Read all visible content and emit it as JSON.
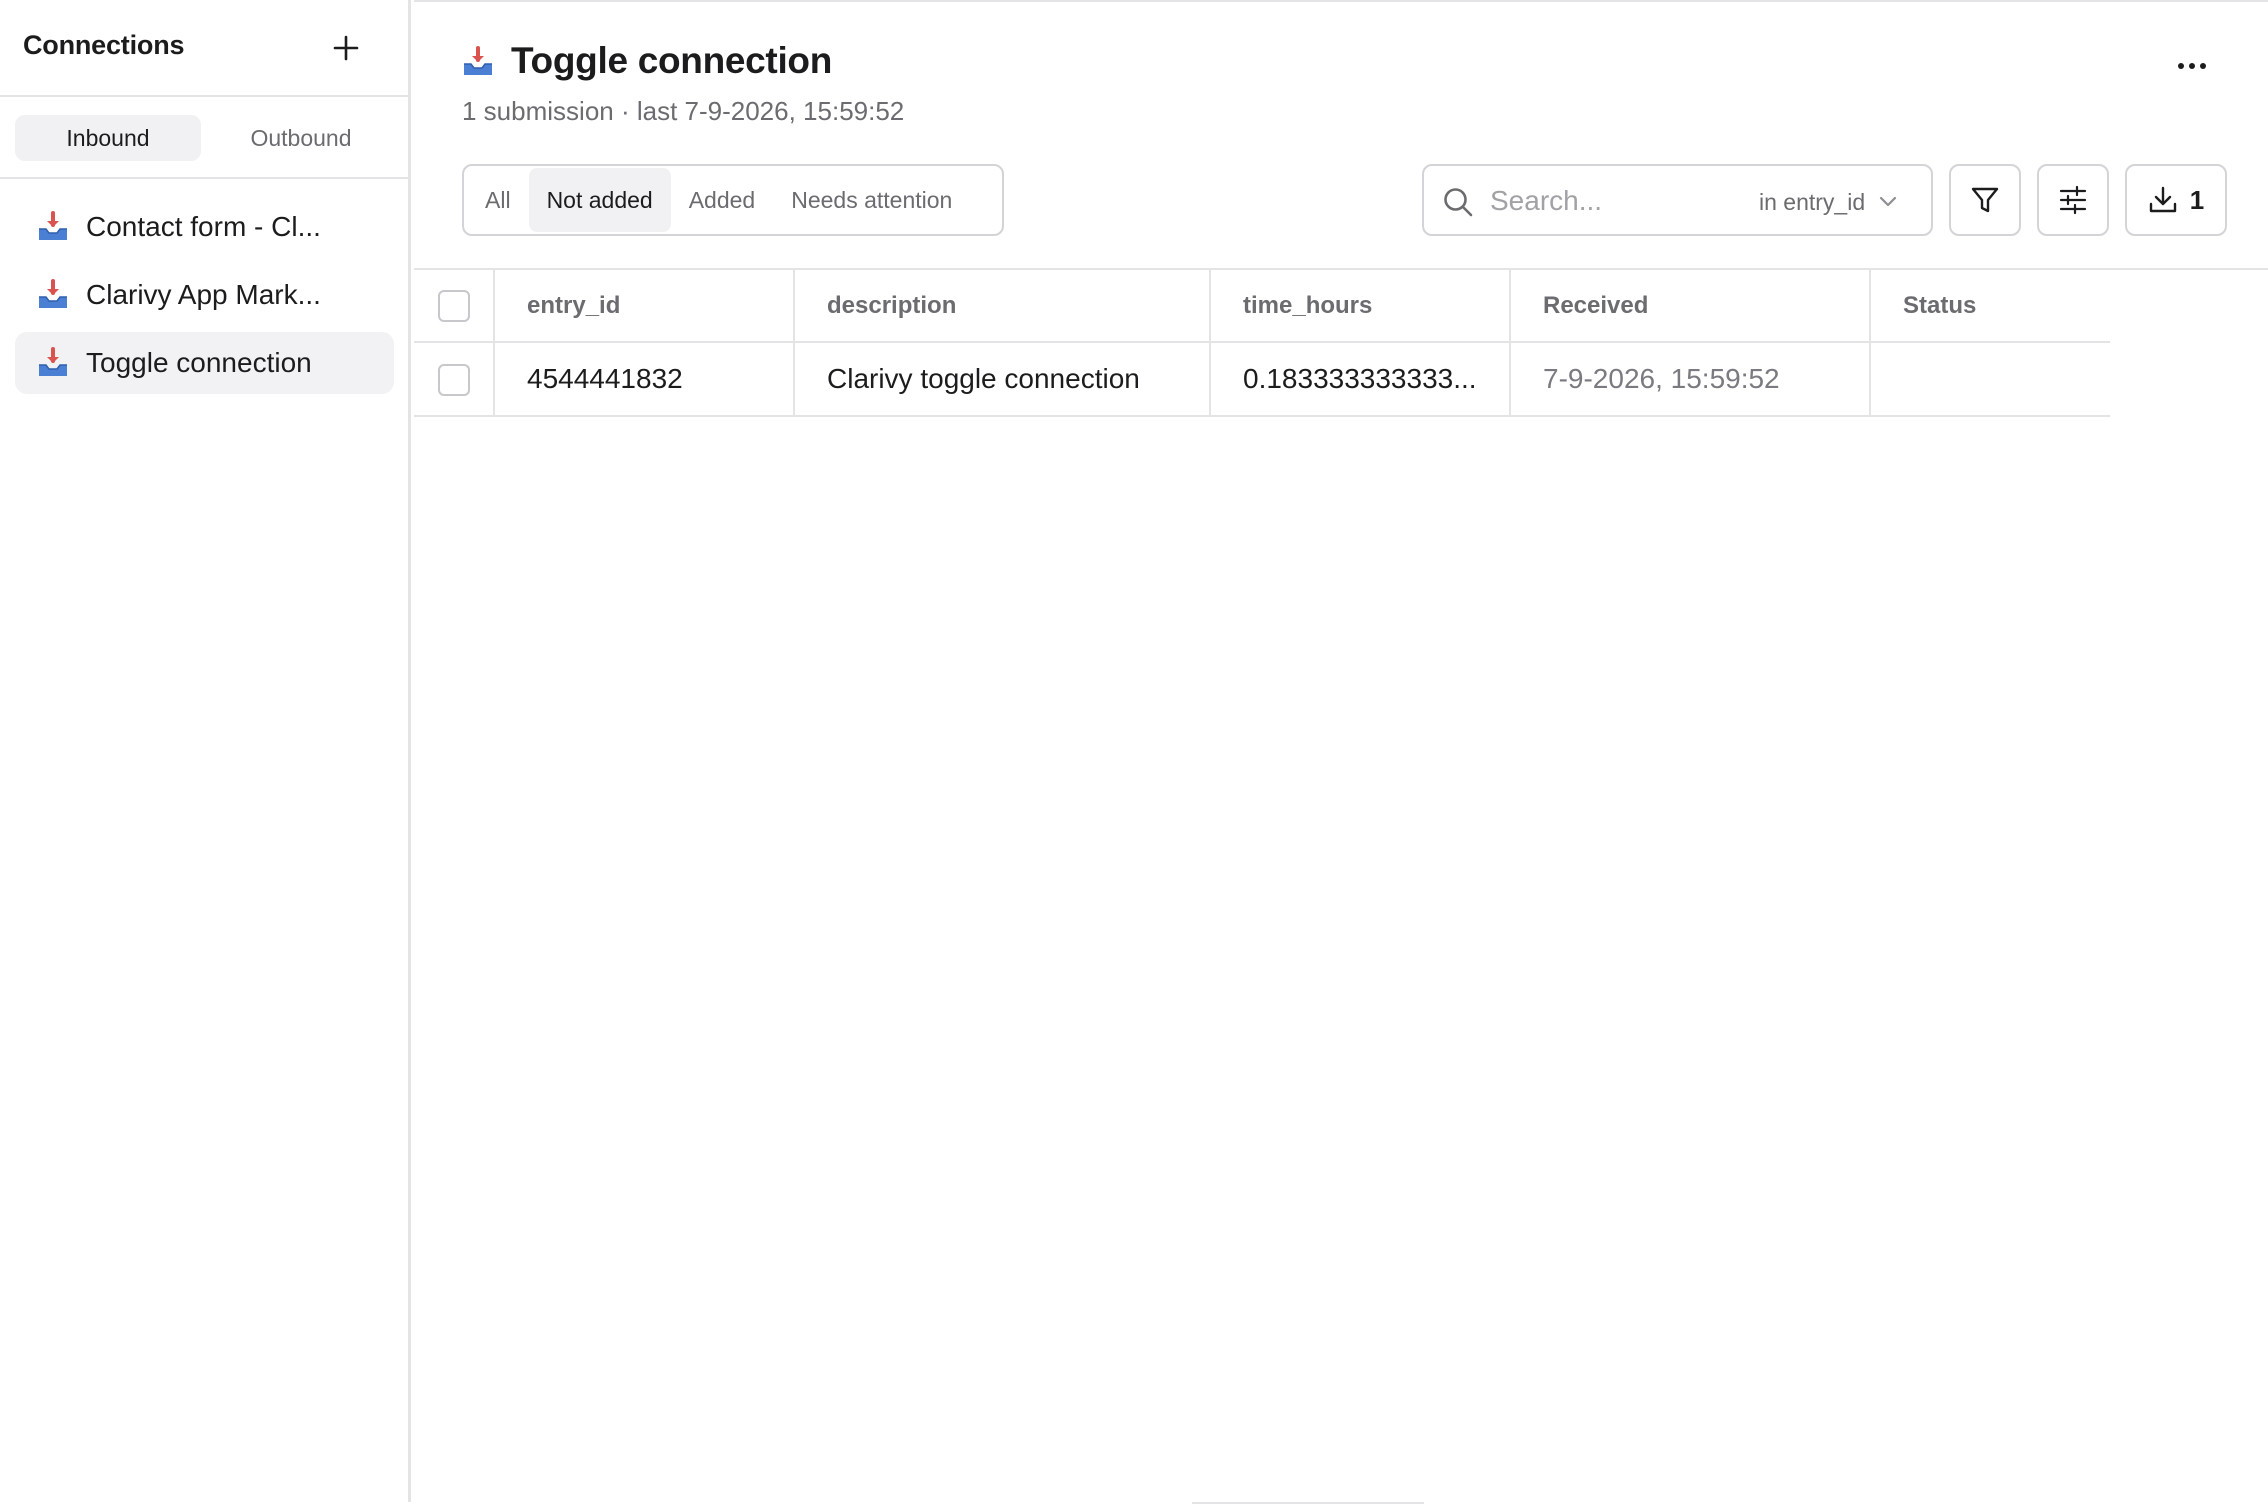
{
  "sidebar": {
    "title": "Connections",
    "tabs": [
      {
        "label": "Inbound",
        "active": true
      },
      {
        "label": "Outbound",
        "active": false
      }
    ],
    "items": [
      {
        "label": "Contact form - Cl...",
        "icon": "inbox-tray-icon",
        "active": false
      },
      {
        "label": "Clarivy App Mark...",
        "icon": "inbox-tray-icon",
        "active": false
      },
      {
        "label": "Toggle connection",
        "icon": "inbox-tray-icon",
        "active": true
      }
    ]
  },
  "header": {
    "title": "Toggle connection",
    "subtitle": "1 submission · last 7-9-2026, 15:59:52"
  },
  "filters": {
    "segments": [
      {
        "label": "All",
        "active": false
      },
      {
        "label": "Not added",
        "active": true
      },
      {
        "label": "Added",
        "active": false
      },
      {
        "label": "Needs attention",
        "active": false
      }
    ]
  },
  "search": {
    "placeholder": "Search...",
    "scope": "in entry_id"
  },
  "toolbar": {
    "download_count": "1"
  },
  "table": {
    "columns": [
      "entry_id",
      "description",
      "time_hours",
      "Received",
      "Status"
    ],
    "rows": [
      {
        "entry_id": "4544441832",
        "description": "Clarivy toggle connection",
        "time_hours": "0.183333333333...",
        "received": "7-9-2026, 15:59:52",
        "status": ""
      }
    ]
  },
  "colors": {
    "border": "#e4e4e7",
    "text": "#1c1c1e",
    "muted": "#6b6b70",
    "active_bg": "#f1f1f3",
    "icon_red": "#d9534f",
    "icon_blue": "#4a7fd4"
  }
}
